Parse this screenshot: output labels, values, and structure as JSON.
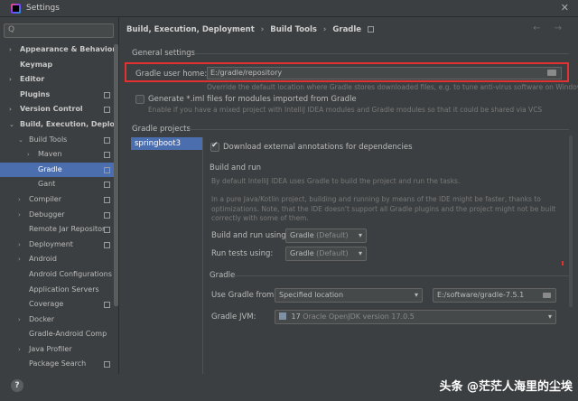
{
  "window": {
    "title": "Settings",
    "close": "✕"
  },
  "sidebar": {
    "search_placeholder": "Q",
    "items": [
      {
        "label": "Appearance & Behavior",
        "chev": "›",
        "bold": true
      },
      {
        "label": "Keymap",
        "chev": "",
        "bold": true
      },
      {
        "label": "Editor",
        "chev": "›",
        "bold": true
      },
      {
        "label": "Plugins",
        "chev": "",
        "bold": true
      },
      {
        "label": "Version Control",
        "chev": "›",
        "bold": true
      },
      {
        "label": "Build, Execution, Deploym",
        "chev": "⌄",
        "bold": true
      },
      {
        "label": "Build Tools",
        "chev": "⌄"
      },
      {
        "label": "Maven",
        "chev": "›"
      },
      {
        "label": "Gradle",
        "chev": "",
        "selected": true
      },
      {
        "label": "Gant",
        "chev": ""
      },
      {
        "label": "Compiler",
        "chev": "›"
      },
      {
        "label": "Debugger",
        "chev": "›"
      },
      {
        "label": "Remote Jar Repositor",
        "chev": ""
      },
      {
        "label": "Deployment",
        "chev": "›"
      },
      {
        "label": "Android",
        "chev": "›"
      },
      {
        "label": "Android Configurations",
        "chev": ""
      },
      {
        "label": "Application Servers",
        "chev": ""
      },
      {
        "label": "Coverage",
        "chev": ""
      },
      {
        "label": "Docker",
        "chev": "›"
      },
      {
        "label": "Gradle-Android Comp",
        "chev": ""
      },
      {
        "label": "Java Profiler",
        "chev": "›"
      },
      {
        "label": "Package Search",
        "chev": ""
      }
    ]
  },
  "breadcrumb": {
    "part1": "Build, Execution, Deployment",
    "sep": "›",
    "part2": "Build Tools",
    "part3": "Gradle",
    "arrows": "← →"
  },
  "general": {
    "title": "General settings",
    "user_home_label": "Gradle user home:",
    "user_home_value": "E:/gradle/repository",
    "user_home_hint": "Override the default location where Gradle stores downloaded files, e.g. to tune anti-virus software on Windows",
    "generate_iml_label": "Generate *.iml files for modules imported from Gradle",
    "generate_iml_hint": "Enable if you have a mixed project with IntelliJ IDEA modules and Gradle modules so that it could be shared via VCS"
  },
  "projects": {
    "title": "Gradle projects",
    "items": [
      "springboot3"
    ],
    "download_annotations_label": "Download external annotations for dependencies"
  },
  "build_run": {
    "title": "Build and run",
    "desc1": "By default IntelliJ IDEA uses Gradle to build the project and run the tasks.",
    "desc2_line1": "In a pure Java/Kotlin project, building and running by means of the IDE might be faster, thanks to",
    "desc2_line2": "optimizations. Note, that the IDE doesn't support all Gradle plugins and the project might not be built",
    "desc2_line3": "correctly with some of them.",
    "build_using_label": "Build and run using:",
    "build_using_value": "Gradle",
    "build_using_suffix": "(Default)",
    "tests_using_label": "Run tests using:",
    "tests_using_value": "Gradle",
    "tests_using_suffix": "(Default)"
  },
  "gradle": {
    "title": "Gradle",
    "use_from_label": "Use Gradle from:",
    "use_from_value": "Specified location",
    "location_value": "E:/software/gradle-7.5.1",
    "jvm_label": "Gradle JVM:",
    "jvm_version": "17",
    "jvm_name": "Oracle OpenJDK version 17.0.5"
  },
  "footer": {
    "help": "?",
    "watermark": "头条 @茫茫人海里的尘埃"
  },
  "colors": {
    "accent": "#4b6eaf",
    "highlight": "#e2312f",
    "background": "#3c3f41"
  }
}
